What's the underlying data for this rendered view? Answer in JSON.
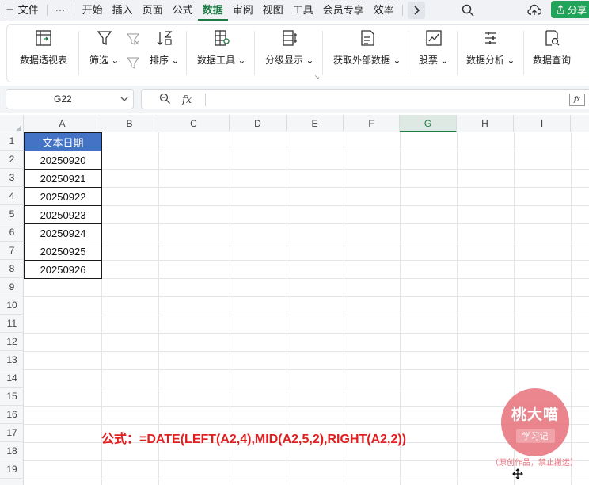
{
  "menubar": {
    "items": [
      "三 文件",
      "⋯",
      "开始",
      "插入",
      "页面",
      "公式",
      "数据",
      "审阅",
      "视图",
      "工具",
      "会员专享",
      "效率"
    ],
    "active_index": 6,
    "share_label": "分享"
  },
  "ribbon": {
    "pivot": "数据透视表",
    "filter": "筛选",
    "sort": "排序",
    "data_tools": "数据工具",
    "group_show": "分级显示",
    "external": "获取外部数据",
    "stocks": "股票",
    "analysis": "数据分析",
    "query": "数据查询"
  },
  "formula_bar": {
    "name_box": "G22",
    "fx_label": "fx",
    "formula": "",
    "fx_right": "fx"
  },
  "columns": [
    "A",
    "B",
    "C",
    "D",
    "E",
    "F",
    "G",
    "H",
    "I"
  ],
  "selected_column": "G",
  "rows": [
    "1",
    "2",
    "3",
    "4",
    "5",
    "6",
    "7",
    "8",
    "9",
    "10",
    "11",
    "12",
    "13",
    "14",
    "15",
    "16",
    "17",
    "18",
    "19"
  ],
  "cells": {
    "header": "文本日期",
    "values": [
      "20250920",
      "20250921",
      "20250922",
      "20250923",
      "20250924",
      "20250925",
      "20250926"
    ]
  },
  "annotation": "公式：=DATE(LEFT(A2,4),MID(A2,5,2),RIGHT(A2,2))",
  "watermark": {
    "title": "桃大喵",
    "subtitle": "学习记",
    "note": "（原创作品，禁止搬运）"
  },
  "colors": {
    "accent": "#1e7a45",
    "header_fill": "#4472c4",
    "annotation": "#e02020",
    "stamp": "#e8707a"
  }
}
